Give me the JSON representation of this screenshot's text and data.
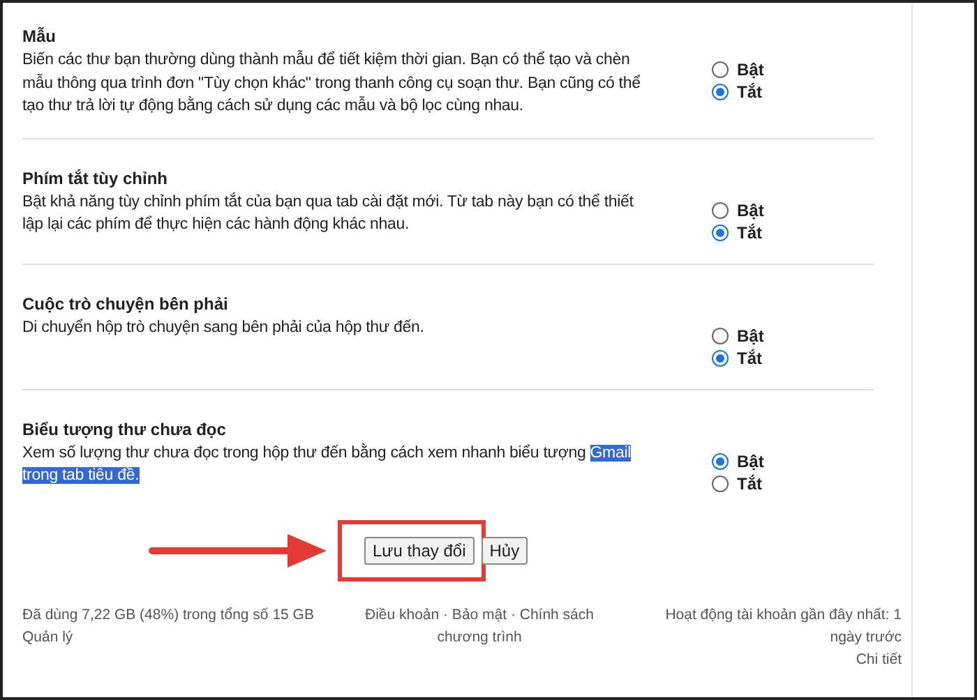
{
  "settings": [
    {
      "title": "Mẫu",
      "description": "Biến các thư bạn thường dùng thành mẫu để tiết kiệm thời gian. Bạn có thể tạo và chèn mẫu thông qua trình đơn \"Tùy chọn khác\" trong thanh công cụ soạn thư. Bạn cũng có thể tạo thư trả lời tự động bằng cách sử dụng các mẫu và bộ lọc cùng nhau.",
      "options": [
        {
          "label": "Bật",
          "selected": false
        },
        {
          "label": "Tắt",
          "selected": true
        }
      ]
    },
    {
      "title": "Phím tắt tùy chỉnh",
      "description": "Bật khả năng tùy chỉnh phím tắt của bạn qua tab cài đặt mới. Từ tab này bạn có thể thiết lập lại các phím để thực hiện các hành động khác nhau.",
      "options": [
        {
          "label": "Bật",
          "selected": false
        },
        {
          "label": "Tắt",
          "selected": true
        }
      ]
    },
    {
      "title": "Cuộc trò chuyện bên phải",
      "description": "Di chuyển hộp trò chuyện sang bên phải của hộp thư đến.",
      "options": [
        {
          "label": "Bật",
          "selected": false
        },
        {
          "label": "Tắt",
          "selected": true
        }
      ]
    },
    {
      "title": "Biểu tượng thư chưa đọc",
      "description": "Xem số lượng thư chưa đọc trong hộp thư đến bằng cách xem nhanh biểu tượng",
      "highlighted_text": "Gmail trong tab tiêu đề.",
      "options": [
        {
          "label": "Bật",
          "selected": true
        },
        {
          "label": "Tắt",
          "selected": false
        }
      ]
    }
  ],
  "buttons": {
    "save": "Lưu thay đổi",
    "cancel": "Hủy"
  },
  "footer": {
    "storage": "Đã dùng 7,22 GB (48%) trong tổng số 15 GB",
    "manage": "Quản lý",
    "legal": "Điều khoản · Bảo mật · Chính sách chương trình",
    "activity": "Hoạt động tài khoản gần đây nhất: 1 ngày trước",
    "details": "Chi tiết"
  }
}
